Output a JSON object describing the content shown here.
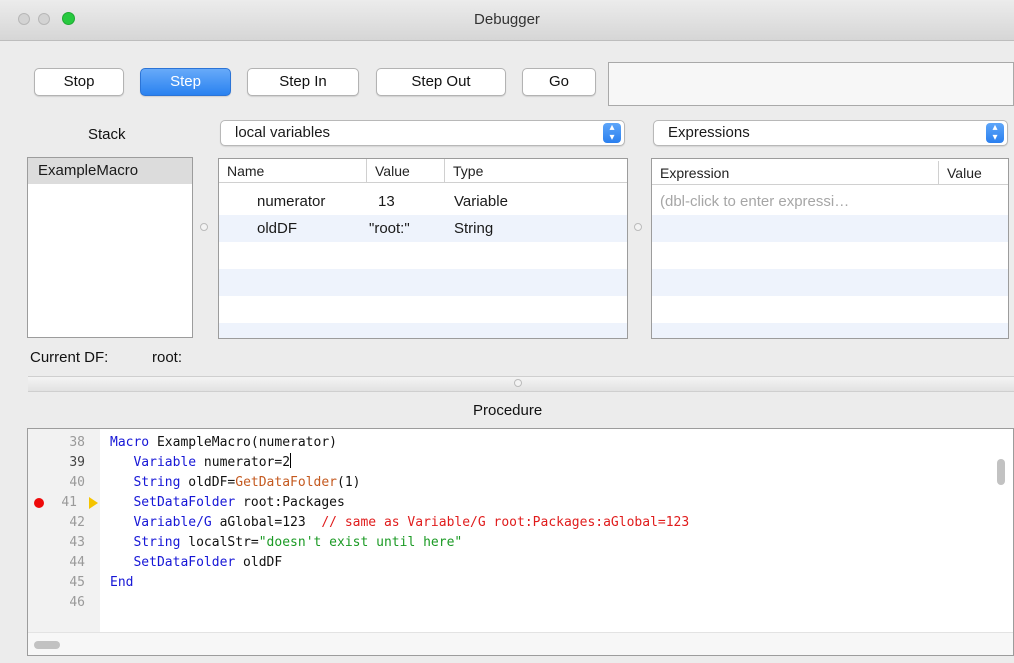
{
  "window": {
    "title": "Debugger"
  },
  "toolbar": {
    "stop": "Stop",
    "step": "Step",
    "step_in": "Step In",
    "step_out": "Step Out",
    "go": "Go"
  },
  "stack": {
    "label": "Stack",
    "items": [
      "ExampleMacro"
    ]
  },
  "variables": {
    "popup_value": "local variables",
    "columns": [
      "Name",
      "Value",
      "Type"
    ],
    "rows": [
      {
        "name": "numerator",
        "value": "13",
        "type": "Variable"
      },
      {
        "name": "oldDF",
        "value": "\"root:\"",
        "type": "String"
      }
    ]
  },
  "expressions": {
    "popup_value": "Expressions",
    "columns": [
      "Expression",
      "Value"
    ],
    "placeholder": "(dbl-click to enter expressi…"
  },
  "current_df": {
    "label": "Current DF:",
    "value": "root:"
  },
  "procedure": {
    "label": "Procedure",
    "line_numbers": [
      "38",
      "39",
      "40",
      "41",
      "42",
      "43",
      "44",
      "45",
      "46"
    ],
    "current_line": "41",
    "breakpoint_line": "41",
    "lines": [
      {
        "kw": "Macro",
        "rest": " ExampleMacro(numerator)"
      },
      {
        "indent": "   ",
        "kw": "Variable",
        "rest": " numerator=2"
      },
      {
        "indent": "   ",
        "kw": "String",
        "rest": " oldDF=",
        "fn": "GetDataFolder",
        "rest2": "(1)"
      },
      {
        "indent": "   ",
        "kw": "SetDataFolder",
        "rest": " root:Packages"
      },
      {
        "indent": "   ",
        "kw": "Variable/G",
        "rest": " aGlobal=123  ",
        "cmt": "// same as Variable/G root:Packages:aGlobal=123"
      },
      {
        "indent": "   ",
        "kw": "String",
        "rest": " localStr=",
        "str": "\"doesn't exist until here\""
      },
      {
        "indent": "   ",
        "kw": "SetDataFolder",
        "rest": " oldDF"
      },
      {
        "kw": "End",
        "rest": ""
      }
    ]
  },
  "colors": {
    "keyword": "#1616d6",
    "function": "#c4591f",
    "string": "#1b9a24",
    "comment": "#e01c1c",
    "breakpoint": "#ee0a0a",
    "pc_arrow": "#f5c400",
    "accent": "#2a82f0"
  },
  "icons": {
    "breakpoint": "breakpoint-dot-icon",
    "pc": "current-line-arrow-icon",
    "popup": "chevron-updown-icon"
  }
}
